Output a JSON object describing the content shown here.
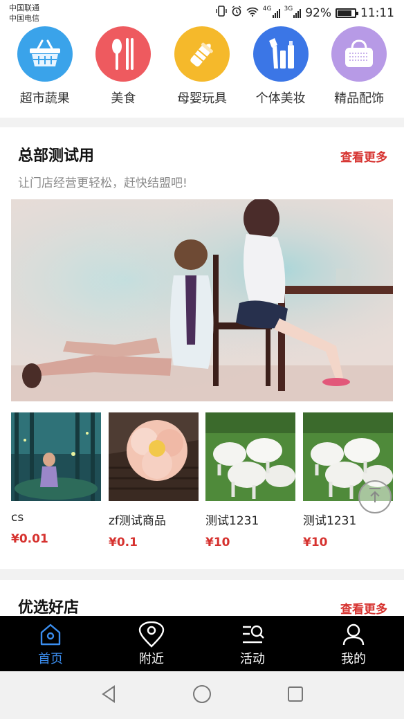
{
  "status_bar": {
    "carrier_1": "中国联通",
    "carrier_2": "中国电信",
    "signal_1_label": "4G",
    "signal_2_label": "3G",
    "battery": "92%",
    "time": "11:11"
  },
  "categories": [
    {
      "label": "超市蔬果",
      "icon": "basket-icon",
      "color": "#3aa3ea"
    },
    {
      "label": "美食",
      "icon": "cutlery-icon",
      "color": "#ee5a5f"
    },
    {
      "label": "母婴玩具",
      "icon": "baby-bottle-icon",
      "color": "#f5b92b"
    },
    {
      "label": "个体美妆",
      "icon": "cosmetics-icon",
      "color": "#3b76e6"
    },
    {
      "label": "精品配饰",
      "icon": "handbag-icon",
      "color": "#b79ae6"
    }
  ],
  "section1": {
    "title": "总部测试用",
    "more": "查看更多",
    "subtitle": "让门店经营更轻松，赶快结盟吧!"
  },
  "products": [
    {
      "name": "cs",
      "price": "¥0.01"
    },
    {
      "name": "zf测试商品",
      "price": "¥0.1"
    },
    {
      "name": "测试1231",
      "price": "¥10"
    },
    {
      "name": "测试1231",
      "price": "¥10"
    }
  ],
  "section2": {
    "title": "优选好店",
    "more": "查看更多"
  },
  "tabs": [
    {
      "label": "首页",
      "icon": "home-icon",
      "active": true
    },
    {
      "label": "附近",
      "icon": "location-pin-icon",
      "active": false
    },
    {
      "label": "活动",
      "icon": "activity-search-icon",
      "active": false
    },
    {
      "label": "我的",
      "icon": "user-icon",
      "active": false
    }
  ],
  "colors": {
    "accent": "#d6322f",
    "tab_active": "#3b8ef0",
    "tabbar_bg": "#000000"
  }
}
